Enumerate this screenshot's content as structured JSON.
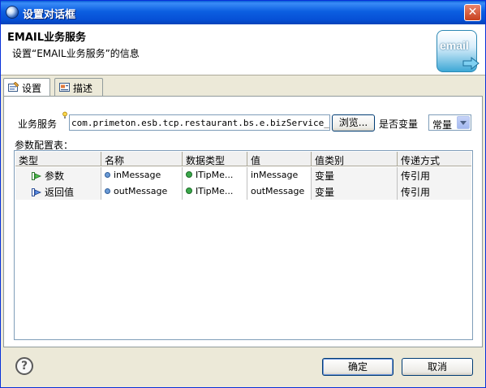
{
  "window": {
    "title": "设置对话框",
    "close_glyph": "✕"
  },
  "header": {
    "title": "EMAIL业务服务",
    "description": "设置“EMAIL业务服务”的信息",
    "logo_text": "email"
  },
  "tabs": [
    {
      "label": "设置",
      "icon": "settings-tab-icon",
      "active": true
    },
    {
      "label": "描述",
      "icon": "describe-tab-icon",
      "active": false
    }
  ],
  "form": {
    "service_label": "业务服务",
    "service_value": "com.primeton.esb.tcp.restaurant.bs.e.bizService_email",
    "browse_label": "浏览...",
    "is_variable_label": "是否变量",
    "is_variable_value": "常量",
    "params_label": "参数配置表："
  },
  "table": {
    "columns": [
      "类型",
      "名称",
      "数据类型",
      "值",
      "值类别",
      "传递方式"
    ],
    "rows": [
      {
        "type": "参数",
        "name": "inMessage",
        "data_type": "ITipMe...",
        "value": "inMessage",
        "value_kind": "变量",
        "pass": "传引用"
      },
      {
        "type": "返回值",
        "name": "outMessage",
        "data_type": "ITipMe...",
        "value": "outMessage",
        "value_kind": "变量",
        "pass": "传引用"
      }
    ]
  },
  "footer": {
    "help_glyph": "?",
    "ok_label": "确定",
    "cancel_label": "取消"
  },
  "colors": {
    "titlebar": "#0650d6",
    "accent": "#0831d9"
  }
}
